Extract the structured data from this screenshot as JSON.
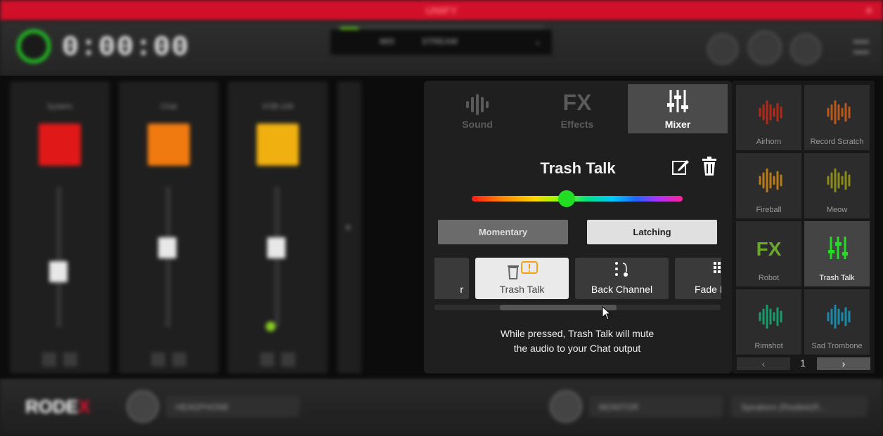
{
  "app": {
    "title": "UNIFY"
  },
  "topbar": {
    "timer": "0:00:00",
    "stream_tabs": [
      "MIX",
      "STREAM"
    ]
  },
  "channels": [
    {
      "name": "System",
      "color": "#e01818"
    },
    {
      "name": "Chat",
      "color": "#f07a10"
    },
    {
      "name": "VOB-106",
      "color": "#f0b010"
    }
  ],
  "bottombar": {
    "logo": "RODE",
    "logo_x": "X",
    "headphone_label": "HEADPHONE",
    "monitor_label": "MONITOR",
    "speakers_label": "Speakers (Realtek(R..."
  },
  "panel": {
    "tabs": [
      {
        "label": "Sound",
        "icon": "waveform-icon"
      },
      {
        "label": "Effects",
        "icon_text": "FX"
      },
      {
        "label": "Mixer",
        "icon": "sliders-icon"
      }
    ],
    "title": "Trash Talk",
    "color_slider_value": 0.45,
    "modes": {
      "momentary": "Momentary",
      "latching": "Latching",
      "selected": "Latching"
    },
    "carousel": [
      {
        "label": "r"
      },
      {
        "label": "Trash Talk",
        "selected": true
      },
      {
        "label": "Back Channel"
      },
      {
        "label": "Fade I"
      }
    ],
    "description": [
      "While pressed, Trash Talk will mute",
      "the audio to your Chat output"
    ]
  },
  "grid": {
    "items": [
      {
        "label": "Airhorn",
        "color": "#b02a1a"
      },
      {
        "label": "Record Scratch",
        "color": "#b8581a"
      },
      {
        "label": "Fireball",
        "color": "#b87a1a"
      },
      {
        "label": "Meow",
        "color": "#8a8a1a"
      },
      {
        "label": "Robot",
        "color": "#6aa82a",
        "icon_text": "FX"
      },
      {
        "label": "Trash Talk",
        "color": "#22dd22",
        "selected": true
      },
      {
        "label": "Rimshot",
        "color": "#1a9a6a"
      },
      {
        "label": "Sad Trombone",
        "color": "#1a8aa8"
      }
    ],
    "page": "1"
  }
}
